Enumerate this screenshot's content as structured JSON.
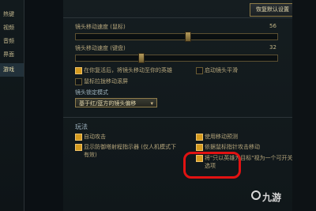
{
  "sidebar": {
    "items": [
      {
        "label": "热键"
      },
      {
        "label": "视频"
      },
      {
        "label": "音频"
      },
      {
        "label": "界面"
      },
      {
        "label": "游戏",
        "active": true
      }
    ]
  },
  "header": {
    "reset_label": "恢复默认设置"
  },
  "camera": {
    "mouse_speed": {
      "label": "镜头移动速度 (鼠标)",
      "value": "56",
      "level": 0.56
    },
    "keyboard_speed": {
      "label": "镜头移动速度 (键盘)",
      "value": "32",
      "level": 0.32
    },
    "options": [
      {
        "label": "在你复活后，将镜头移动至你的英雄",
        "checked": true
      },
      {
        "label": "启动镜头平滑",
        "checked": false
      },
      {
        "label": "鼠标拉拢移动滚屏",
        "checked": false
      }
    ],
    "lock_mode": {
      "label": "镜头锁定模式",
      "selected": "基于红/蓝方的镜头偏移"
    }
  },
  "gameplay": {
    "title": "玩法",
    "options": [
      {
        "label": "自动攻击",
        "checked": true
      },
      {
        "label": "显示防御塔射程指示器 (仅人机模式下",
        "checked": true
      },
      {
        "label": "有效)",
        "checked": null
      },
      {
        "label": "使用移动预测",
        "checked": true
      },
      {
        "label": "依据鼠标指针攻击移动",
        "checked": true
      },
      {
        "label": "将\"只以英雄为目标\"视为一个可开关",
        "checked": true
      },
      {
        "label": "选项",
        "checked": null
      }
    ]
  },
  "watermark": {
    "text": "九游"
  },
  "colors": {
    "accent": "#d59b1f",
    "highlight": "#e11212"
  }
}
